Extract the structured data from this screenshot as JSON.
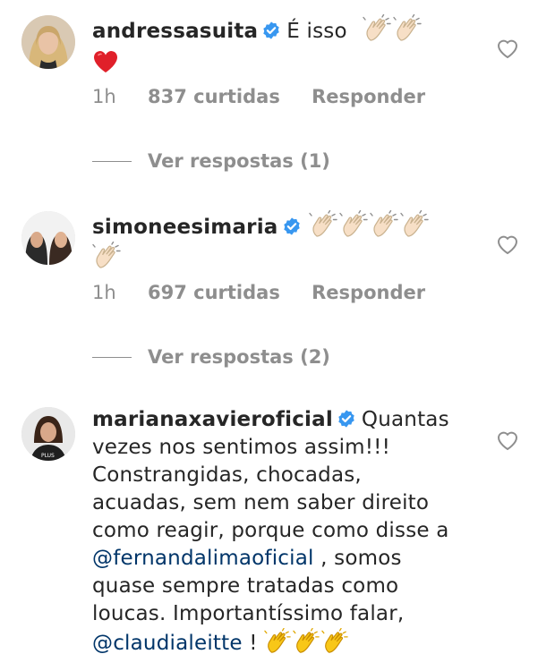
{
  "comments": [
    {
      "username": "andressasuita",
      "text": "É isso",
      "emojis": [
        "clap",
        "clap",
        "heart"
      ],
      "time": "1h",
      "likes": "837 curtidas",
      "reply": "Responder",
      "view_replies": "Ver respostas (1)"
    },
    {
      "username": "simoneesimaria",
      "emojis": [
        "clap",
        "clap",
        "clap",
        "clap",
        "clap"
      ],
      "time": "1h",
      "likes": "697 curtidas",
      "reply": "Responder",
      "view_replies": "Ver respostas (2)"
    },
    {
      "username": "marianaxavieroficial",
      "text_part1": "Quantas vezes nos sentimos assim!!! Constrangidas,  chocadas, acuadas, sem nem saber direito como reagir, porque como disse a",
      "mention1": "@fernandalimaoficial",
      "text_part2": ", somos quase sempre tratadas como loucas. Importantíssimo falar,",
      "mention2": "@claudialeitte",
      "text_part3": "!",
      "emojis": [
        "clap-yellow",
        "clap-yellow",
        "clap-yellow"
      ]
    }
  ],
  "colors": {
    "text": "#262626",
    "meta": "#8e8e8e",
    "mention": "#003569",
    "verified": "#3897f0"
  }
}
